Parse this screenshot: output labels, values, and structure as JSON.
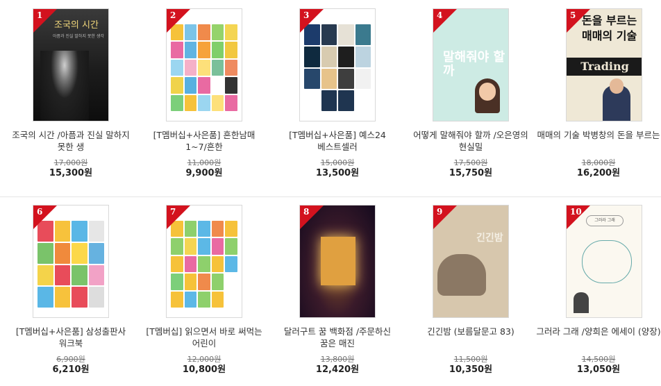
{
  "books": [
    {
      "rank": "1",
      "title": "조국의 시간 /아픔과 진실 말하지 못한 생",
      "orig": "17,000원",
      "price": "15,300원"
    },
    {
      "rank": "2",
      "title": "[T멤버십+사은품] 흔한남매 1~7/흔한",
      "orig": "11,000원",
      "price": "9,900원"
    },
    {
      "rank": "3",
      "title": "[T멤버십+사은품] 예스24 베스트셀러",
      "orig": "15,000원",
      "price": "13,500원"
    },
    {
      "rank": "4",
      "title": "어떻게 말해줘야 할까 /오은영의 현실밀",
      "orig": "17,500원",
      "price": "15,750원"
    },
    {
      "rank": "5",
      "title": "매매의 기술 박병창의 돈을 부르는",
      "orig": "18,000원",
      "price": "16,200원"
    },
    {
      "rank": "6",
      "title": "[T멤버십+사은품] 삼성출판사 워크북",
      "orig": "6,900원",
      "price": "6,210원"
    },
    {
      "rank": "7",
      "title": "[T멤버십] 읽으면서 바로 써먹는 어린이",
      "orig": "12,000원",
      "price": "10,800원"
    },
    {
      "rank": "8",
      "title": "달러구트 꿈 백화점 /주문하신 꿈은 매진",
      "orig": "13,800원",
      "price": "12,420원"
    },
    {
      "rank": "9",
      "title": "긴긴밤 (보름달문고 83)",
      "orig": "11,500원",
      "price": "10,350원"
    },
    {
      "rank": "10",
      "title": "그러라 그래 /양희은 에세이 (양장)",
      "orig": "14,500원",
      "price": "13,050원"
    }
  ],
  "covers": {
    "c1_title": "조국의 시간",
    "c1_sub": "아픔과 진실 말하지 못한 생각",
    "c4_text": "말해줘야 할까",
    "c5_title1": "돈을 부르는",
    "c5_title2": "매매의 기술",
    "c5_band": "Trading",
    "c9_title": "긴긴밤",
    "c10_bubble": "그러라 그래"
  },
  "colors": {
    "rank_badge": "#d3121e",
    "price": "#222222",
    "original_price": "#777777"
  }
}
